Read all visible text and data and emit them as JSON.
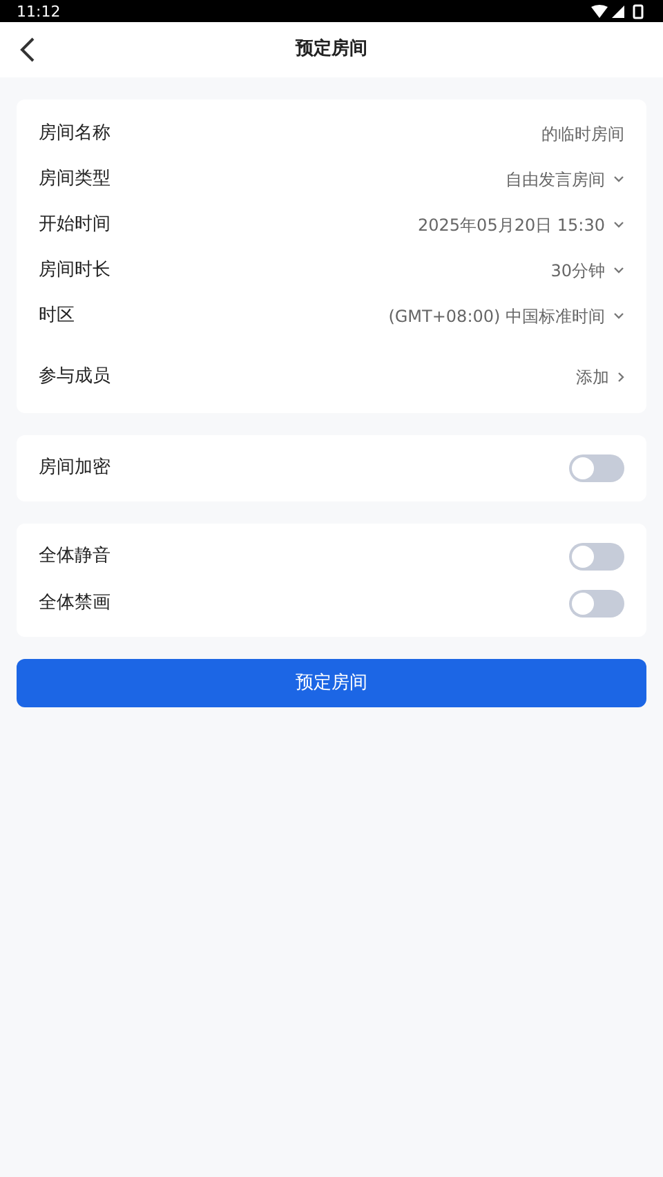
{
  "status_bar": {
    "time": "11:12"
  },
  "header": {
    "title": "预定房间"
  },
  "details": [
    {
      "label": "房间名称",
      "value": "的临时房间",
      "kind": "text"
    },
    {
      "label": "房间类型",
      "value": "自由发言房间",
      "kind": "select"
    },
    {
      "label": "开始时间",
      "value": "2025年05月20日 15:30",
      "kind": "select"
    },
    {
      "label": "房间时长",
      "value": "30分钟",
      "kind": "select"
    },
    {
      "label": "时区",
      "value": "(GMT+08:00) 中国标准时间",
      "kind": "select"
    },
    {
      "label": "参与成员",
      "value": "添加",
      "kind": "link"
    }
  ],
  "security": [
    {
      "label": "房间加密",
      "on": false
    }
  ],
  "controls": [
    {
      "label": "全体静音",
      "on": false
    },
    {
      "label": "全体禁画",
      "on": false
    }
  ],
  "submit_button": "预定房间"
}
